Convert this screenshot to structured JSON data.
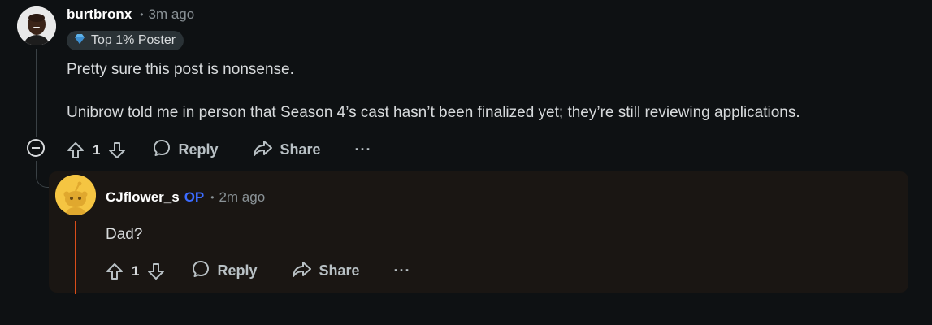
{
  "parent_comment": {
    "username": "burtbronx",
    "timestamp": "3m ago",
    "flair": {
      "icon": "diamond-flair-icon",
      "label": "Top 1% Poster"
    },
    "body": [
      "Pretty sure this post is nonsense.",
      "Unibrow told me in person that Season 4’s cast hasn’t been finalized yet; they’re still reviewing applications."
    ],
    "actions": {
      "vote_count": "1",
      "reply_label": "Reply",
      "share_label": "Share",
      "more_label": "···"
    }
  },
  "reply_comment": {
    "username": "CJflower_s",
    "op_tag": "OP",
    "timestamp": "2m ago",
    "body": "Dad?",
    "actions": {
      "vote_count": "1",
      "reply_label": "Reply",
      "share_label": "Share",
      "more_label": "···"
    }
  },
  "colors": {
    "background": "#0e1113",
    "reply_card": "#1a1613",
    "op_blue": "#3b6bff",
    "reply_accent": "#d94d1a"
  }
}
